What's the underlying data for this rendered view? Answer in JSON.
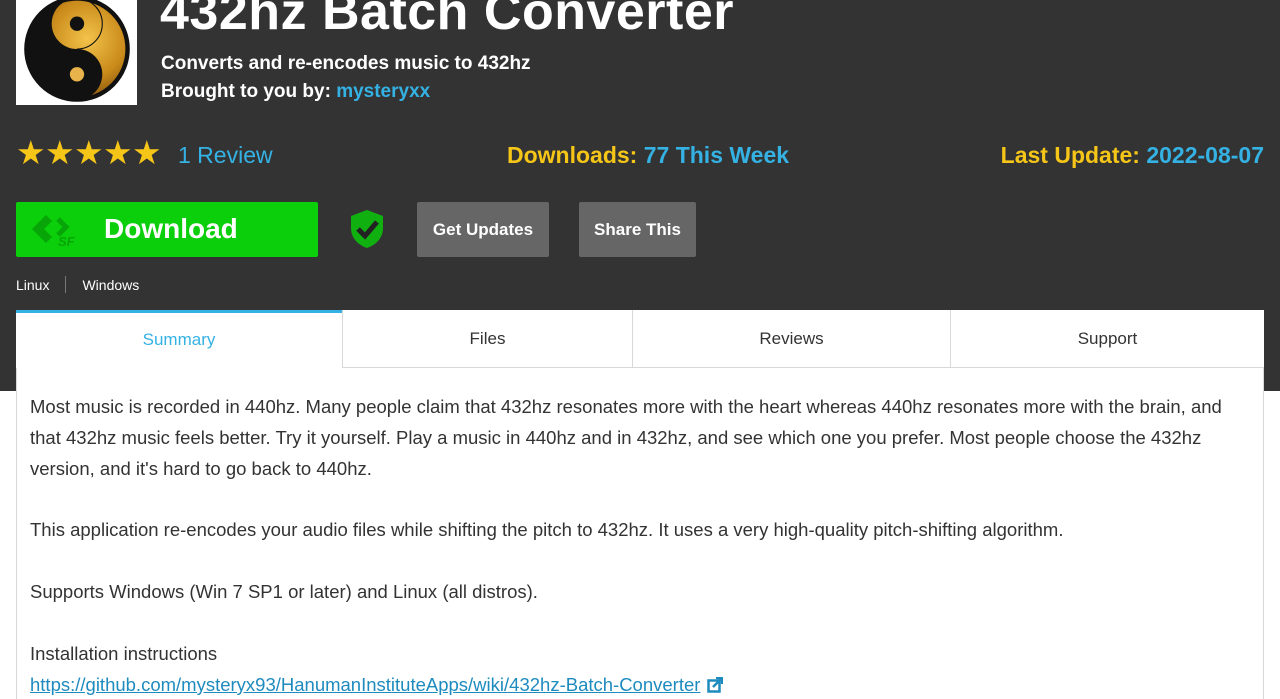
{
  "project": {
    "title": "432hz Batch Converter",
    "subtitle": "Converts and re-encodes music to 432hz",
    "byline_label": "Brought to you by:",
    "author": "mysteryxx"
  },
  "rating": {
    "stars": 5,
    "star_glyph": "★",
    "review_link": "1 Review"
  },
  "stats": {
    "downloads_label": "Downloads:",
    "downloads_value": "77 This Week",
    "update_label": "Last Update:",
    "update_value": "2022-08-07"
  },
  "actions": {
    "download_label": "Download",
    "get_updates_label": "Get Updates",
    "share_label": "Share This"
  },
  "platforms": [
    "Linux",
    "Windows"
  ],
  "tabs": [
    {
      "label": "Summary",
      "active": true
    },
    {
      "label": "Files",
      "active": false
    },
    {
      "label": "Reviews",
      "active": false
    },
    {
      "label": "Support",
      "active": false
    }
  ],
  "summary": {
    "p1": "Most music is recorded in 440hz. Many people claim that 432hz resonates more with the heart whereas 440hz resonates more with the brain, and that 432hz music feels better. Try it yourself. Play a music in 440hz and in 432hz, and see which one you prefer. Most people choose the 432hz version, and it's hard to go back to 440hz.",
    "p2": "This application re-encodes your audio files while shifting the pitch to 432hz. It uses a very high-quality pitch-shifting algorithm.",
    "p3": "Supports Windows (Win 7 SP1 or later) and Linux (all distros).",
    "p4": "Installation instructions",
    "link": "https://github.com/mysteryx93/HanumanInstituteApps/wiki/432hz-Batch-Converter"
  },
  "colors": {
    "header_bg": "#333333",
    "accent_blue": "#34b2e4",
    "star_yellow": "#f5c518",
    "download_green": "#0bcf0b",
    "button_gray": "#666666"
  },
  "icons": {
    "logo": "yin-yang-logo",
    "sf": "sourceforge-icon",
    "shield": "shield-check-icon",
    "external": "external-link-icon"
  }
}
